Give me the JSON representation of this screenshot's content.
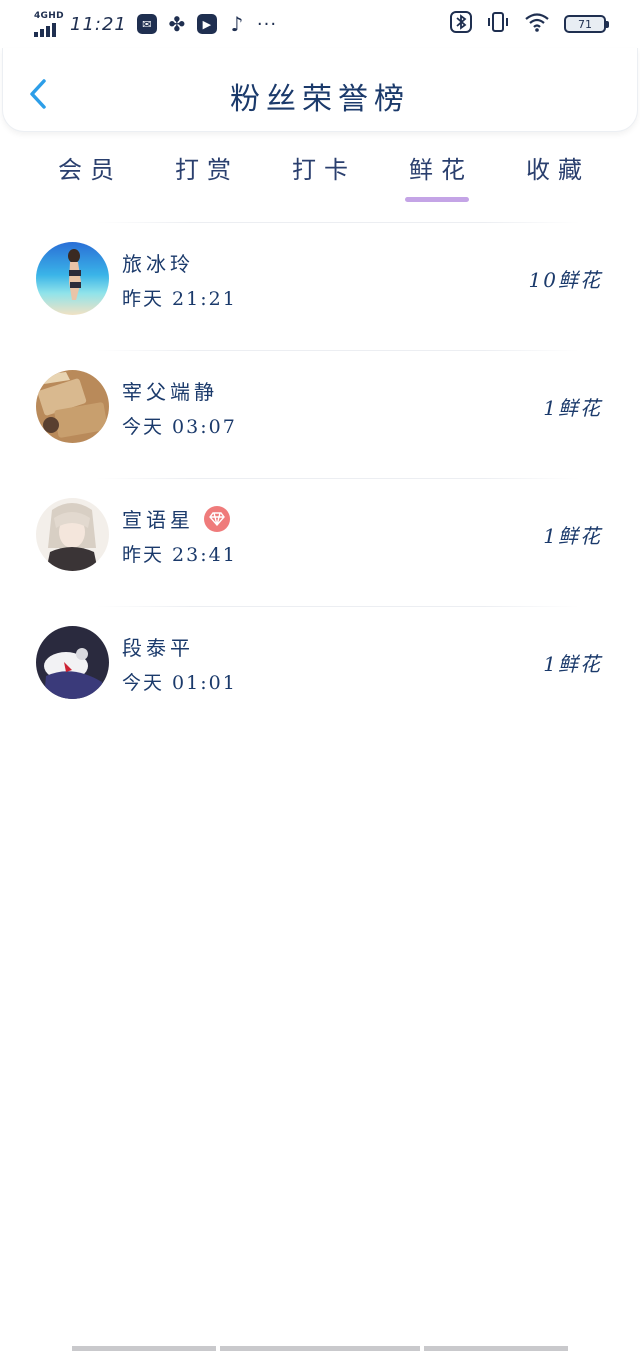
{
  "status_bar": {
    "network": "4GHD",
    "time": "11:21",
    "battery": "71",
    "more": "···",
    "icons": [
      "mail-icon",
      "pinwheel-icon",
      "play-icon",
      "tiktok-icon",
      "bluetooth-icon",
      "vibrate-icon",
      "wifi-icon",
      "battery-icon"
    ]
  },
  "header": {
    "title": "粉丝荣誉榜",
    "back_icon": "chevron-left-icon"
  },
  "tabs": [
    {
      "label": "会员",
      "active": false
    },
    {
      "label": "打赏",
      "active": false
    },
    {
      "label": "打卡",
      "active": false
    },
    {
      "label": "鲜花",
      "active": true
    },
    {
      "label": "收藏",
      "active": false
    }
  ],
  "accent_color": "#c4a4e6",
  "back_color": "#2d9ee8",
  "fans": [
    {
      "name": "旅冰玲",
      "time": "昨天 21:21",
      "count": "10鲜花",
      "vip": false
    },
    {
      "name": "宰父端静",
      "time": "今天 03:07",
      "count": "1鲜花",
      "vip": false
    },
    {
      "name": "宣语星",
      "time": "昨天 23:41",
      "count": "1鲜花",
      "vip": true
    },
    {
      "name": "段泰平",
      "time": "今天 01:01",
      "count": "1鲜花",
      "vip": false
    }
  ]
}
